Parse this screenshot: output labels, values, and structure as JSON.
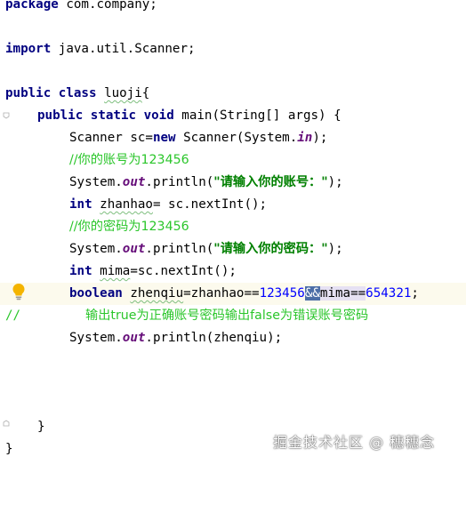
{
  "editor": {
    "lines": {
      "l1": {
        "kw": "package",
        "rest": " com.company;"
      },
      "l3": {
        "kw": "import",
        "rest": " java.util.Scanner;"
      },
      "l5": {
        "kw1": "public",
        "kw2": "class",
        "name": "luoji",
        "rest": "{"
      },
      "l6": {
        "kw1": "public",
        "kw2": "static",
        "kw3": "void",
        "rest": " main(String[] args) {"
      },
      "l7": {
        "a": "Scanner sc=",
        "kw": "new",
        "b": " Scanner(System.",
        "field": "in",
        "c": ");"
      },
      "l8": {
        "comment": "//你的账号为123456"
      },
      "l9": {
        "a": "System.",
        "field": "out",
        "b": ".println(",
        "str": "\"请输入你的账号：\"",
        "c": ");"
      },
      "l10": {
        "kw": "int",
        "var": "zhanhao",
        "rest": "= sc.nextInt();"
      },
      "l11": {
        "comment": "//你的密码为123456"
      },
      "l12": {
        "a": "System.",
        "field": "out",
        "b": ".println(",
        "str": "\"请输入你的密码：\"",
        "c": ");"
      },
      "l13": {
        "kw": "int",
        "var": "mima",
        "rest": "=sc.nextInt();"
      },
      "l14": {
        "kw": "boolean",
        "var": "zhenqiu",
        "a": "=zhanhao==",
        "num1": "123456",
        "op": "&&",
        "b": "mima==",
        "num2": "654321",
        "c": ";"
      },
      "l15": {
        "slashes": "//",
        "comment": "输出true为正确账号密码输出false为错误账号密码"
      },
      "l16": {
        "a": "System.",
        "field": "out",
        "b": ".println(zhenqiu);"
      },
      "l20": {
        "text": "}"
      },
      "l21": {
        "text": "}"
      }
    }
  },
  "icons": {
    "bulb": "lightbulb-icon",
    "fold": "fold-marker-icon"
  },
  "watermark": {
    "text": "掘金技术社区 @ 穗穗念"
  },
  "colors": {
    "keyword": "#000080",
    "string": "#008000",
    "comment": "#2bc62b",
    "field": "#660e7a",
    "number": "#0000ff",
    "current_line": "#fcfaed",
    "bulb": "#f4b400"
  }
}
